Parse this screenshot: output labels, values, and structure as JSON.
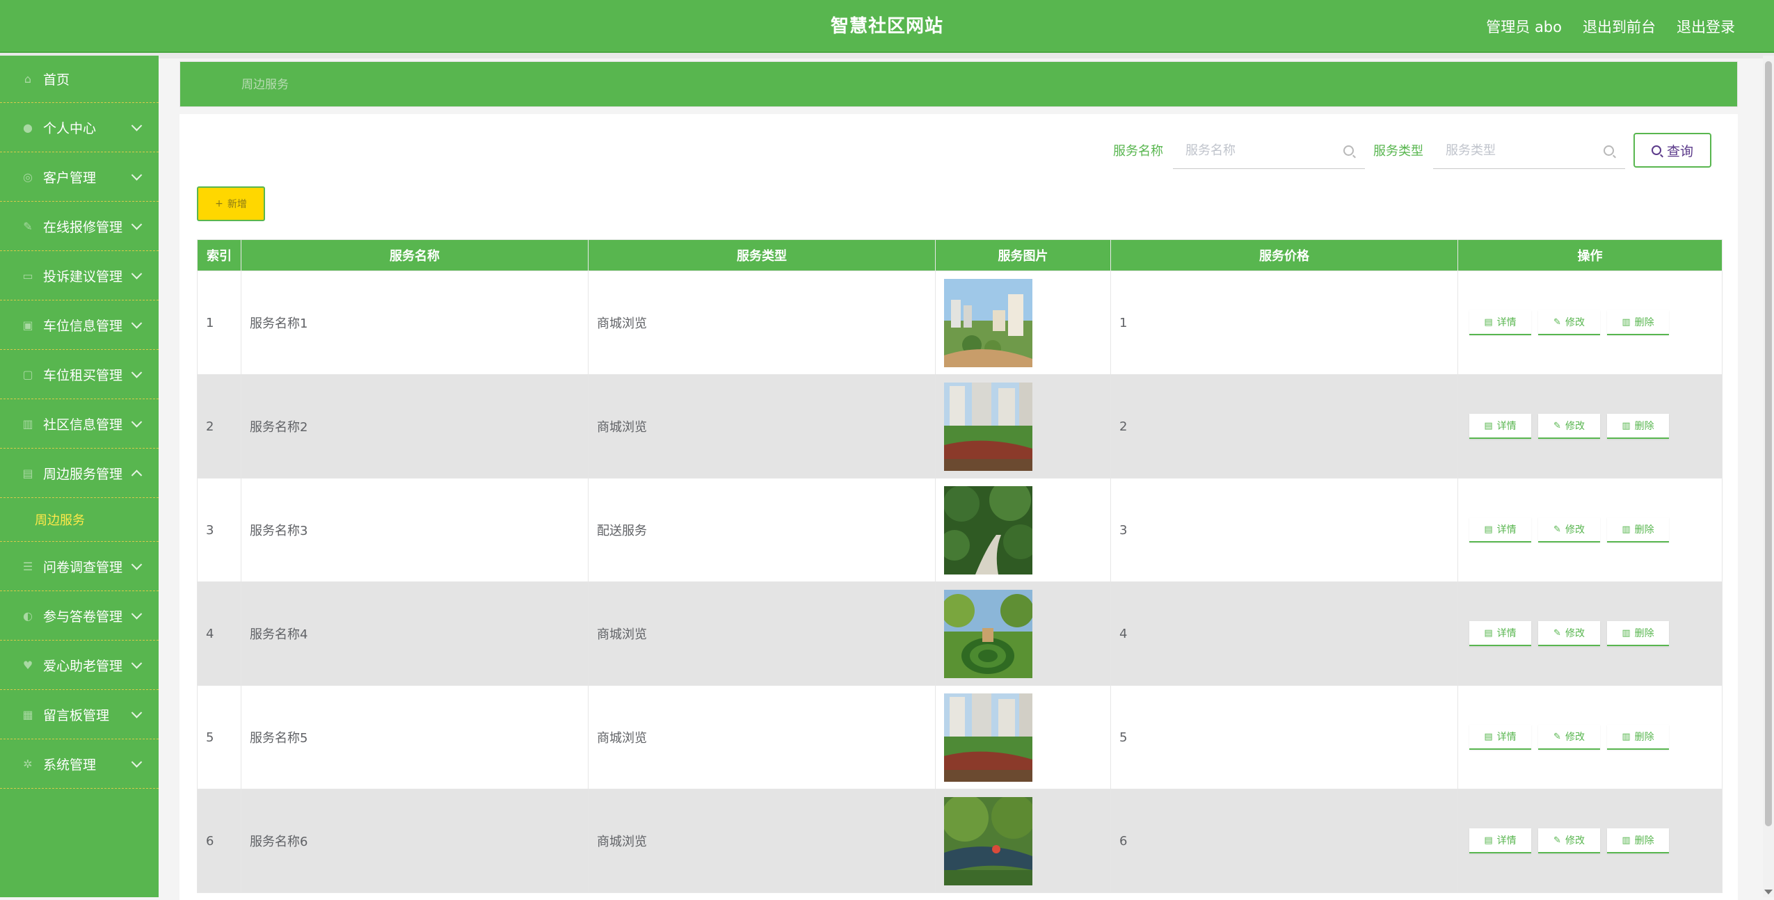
{
  "header": {
    "title": "智慧社区网站",
    "user_label": "管理员 abo",
    "front_link": "退出到前台",
    "logout_link": "退出登录"
  },
  "sidebar": {
    "items": [
      {
        "label": "首页",
        "icon": "home-icon",
        "has_arrow": false
      },
      {
        "label": "个人中心",
        "icon": "user-icon",
        "has_arrow": true
      },
      {
        "label": "客户管理",
        "icon": "users-icon",
        "has_arrow": true
      },
      {
        "label": "在线报修管理",
        "icon": "wrench-icon",
        "has_arrow": true
      },
      {
        "label": "投诉建议管理",
        "icon": "chat-icon",
        "has_arrow": true
      },
      {
        "label": "车位信息管理",
        "icon": "parking-icon",
        "has_arrow": true
      },
      {
        "label": "车位租买管理",
        "icon": "car-icon",
        "has_arrow": true
      },
      {
        "label": "社区信息管理",
        "icon": "building-icon",
        "has_arrow": true
      },
      {
        "label": "周边服务管理",
        "icon": "service-icon",
        "has_arrow": true,
        "expanded": true
      },
      {
        "label": "问卷调查管理",
        "icon": "survey-icon",
        "has_arrow": true
      },
      {
        "label": "参与答卷管理",
        "icon": "answer-icon",
        "has_arrow": true
      },
      {
        "label": "爱心助老管理",
        "icon": "heart-icon",
        "has_arrow": true
      },
      {
        "label": "留言板管理",
        "icon": "message-icon",
        "has_arrow": true
      },
      {
        "label": "系统管理",
        "icon": "settings-icon",
        "has_arrow": true
      }
    ],
    "active_sub": "周边服务"
  },
  "breadcrumb": {
    "current": "周边服务"
  },
  "search": {
    "name_label": "服务名称",
    "name_placeholder": "服务名称",
    "name_value": "",
    "type_label": "服务类型",
    "type_placeholder": "服务类型",
    "type_value": "",
    "query_button": "查询"
  },
  "toolbar": {
    "add_button": "新增",
    "add_icon": "plus-icon"
  },
  "table": {
    "columns": [
      "索引",
      "服务名称",
      "服务类型",
      "服务图片",
      "服务价格",
      "操作"
    ],
    "actions": {
      "detail": "详情",
      "edit": "修改",
      "delete": "删除"
    },
    "rows": [
      {
        "index": "1",
        "name": "服务名称1",
        "type": "商城浏览",
        "price": "1",
        "scene": "aerial-complex"
      },
      {
        "index": "2",
        "name": "服务名称2",
        "type": "商城浏览",
        "price": "2",
        "scene": "towers-deck"
      },
      {
        "index": "3",
        "name": "服务名称3",
        "type": "配送服务",
        "price": "3",
        "scene": "garden-path"
      },
      {
        "index": "4",
        "name": "服务名称4",
        "type": "商城浏览",
        "price": "4",
        "scene": "maze-garden"
      },
      {
        "index": "5",
        "name": "服务名称5",
        "type": "商城浏览",
        "price": "5",
        "scene": "towers-deck"
      },
      {
        "index": "6",
        "name": "服务名称6",
        "type": "商城浏览",
        "price": "6",
        "scene": "willow-stream"
      }
    ]
  },
  "colors": {
    "primary_green": "#58b64f",
    "add_button_yellow": "#ffd700",
    "active_submenu": "#ffe94a",
    "row_alt": "#e4e4e4"
  }
}
